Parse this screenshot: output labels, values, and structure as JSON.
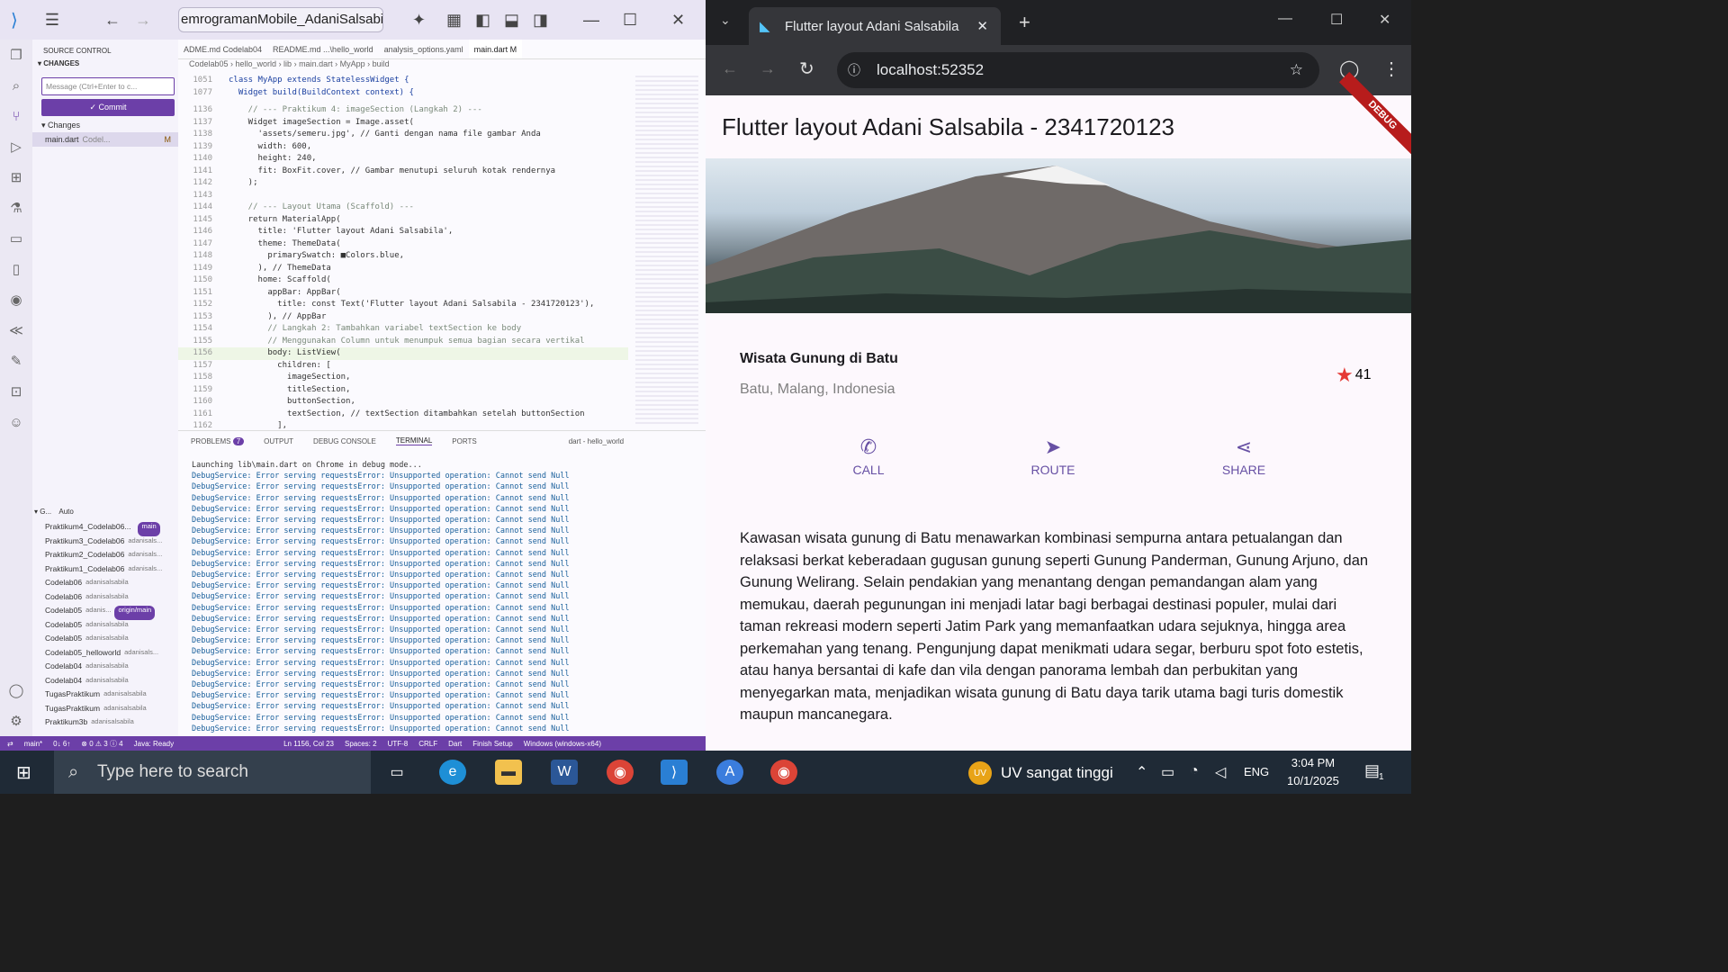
{
  "vscode": {
    "search_text": "emrogramanMobile_AdaniSalsabila",
    "sidebar": {
      "title": "SOURCE CONTROL",
      "changes_header": "CHANGES",
      "message_placeholder": "Message (Ctrl+Enter to c...",
      "commit_label": "✓ Commit",
      "changes_group": "Changes",
      "changed_file": "main.dart",
      "changed_file_path": "Codel...",
      "changed_file_status": "M",
      "graph_header": "G...",
      "graph_auto": "Auto",
      "commits": [
        {
          "msg": "Praktikum4_Codelab06...",
          "author": "",
          "badge": "main"
        },
        {
          "msg": "Praktikum3_Codelab06",
          "author": "adanisals..."
        },
        {
          "msg": "Praktikum2_Codelab06",
          "author": "adanisals..."
        },
        {
          "msg": "Praktikum1_Codelab06",
          "author": "adanisals..."
        },
        {
          "msg": "Codelab06",
          "author": "adanisalsabila"
        },
        {
          "msg": "Codelab06",
          "author": "adanisalsabila"
        },
        {
          "msg": "Codelab05",
          "author": "adanis...",
          "badge": "origin/main"
        },
        {
          "msg": "Codelab05",
          "author": "adanisalsabila"
        },
        {
          "msg": "Codelab05",
          "author": "adanisalsabila"
        },
        {
          "msg": "Codelab05_helloworld",
          "author": "adanisals..."
        },
        {
          "msg": "Codelab04",
          "author": "adanisalsabila"
        },
        {
          "msg": "Codelab04",
          "author": "adanisalsabila"
        },
        {
          "msg": "TugasPraktikum",
          "author": "adanisalsabila"
        },
        {
          "msg": "TugasPraktikum",
          "author": "adanisalsabila"
        },
        {
          "msg": "Praktikum3b",
          "author": "adanisalsabila"
        }
      ]
    },
    "tabs": [
      "ADME.md Codelab04",
      "README.md ...\\hello_world",
      "analysis_options.yaml",
      "main.dart M"
    ],
    "breadcrumb": "Codelab05 › hello_world › lib › main.dart › MyApp › build",
    "sticky": [
      {
        "n": "1051",
        "t": "class MyApp extends StatelessWidget {"
      },
      {
        "n": "1077",
        "t": "  Widget build(BuildContext context) {"
      }
    ],
    "code": [
      {
        "n": "1136",
        "t": "    // --- Praktikum 4: imageSection (Langkah 2) ---"
      },
      {
        "n": "1137",
        "t": "    Widget imageSection = Image.asset("
      },
      {
        "n": "1138",
        "t": "      'assets/semeru.jpg', // Ganti dengan nama file gambar Anda"
      },
      {
        "n": "1139",
        "t": "      width: 600,"
      },
      {
        "n": "1140",
        "t": "      height: 240,"
      },
      {
        "n": "1141",
        "t": "      fit: BoxFit.cover, // Gambar menutupi seluruh kotak rendernya"
      },
      {
        "n": "1142",
        "t": "    );"
      },
      {
        "n": "1143",
        "t": ""
      },
      {
        "n": "1144",
        "t": "    // --- Layout Utama (Scaffold) ---"
      },
      {
        "n": "1145",
        "t": "    return MaterialApp("
      },
      {
        "n": "1146",
        "t": "      title: 'Flutter layout Adani Salsabila',"
      },
      {
        "n": "1147",
        "t": "      theme: ThemeData("
      },
      {
        "n": "1148",
        "t": "        primarySwatch: ■Colors.blue,"
      },
      {
        "n": "1149",
        "t": "      ), // ThemeData"
      },
      {
        "n": "1150",
        "t": "      home: Scaffold("
      },
      {
        "n": "1151",
        "t": "        appBar: AppBar("
      },
      {
        "n": "1152",
        "t": "          title: const Text('Flutter layout Adani Salsabila - 2341720123'),"
      },
      {
        "n": "1153",
        "t": "        ), // AppBar"
      },
      {
        "n": "1154",
        "t": "        // Langkah 2: Tambahkan variabel textSection ke body"
      },
      {
        "n": "1155",
        "t": "        // Menggunakan Column untuk menumpuk semua bagian secara vertikal"
      },
      {
        "n": "1156",
        "t": "        body: ListView("
      },
      {
        "n": "1157",
        "t": "          children: ["
      },
      {
        "n": "1158",
        "t": "            imageSection,"
      },
      {
        "n": "1159",
        "t": "            titleSection,"
      },
      {
        "n": "1160",
        "t": "            buttonSection,"
      },
      {
        "n": "1161",
        "t": "            textSection, // textSection ditambahkan setelah buttonSection"
      },
      {
        "n": "1162",
        "t": "          ],"
      }
    ],
    "panel_tabs": [
      "PROBLEMS",
      "OUTPUT",
      "DEBUG CONSOLE",
      "TERMINAL",
      "PORTS"
    ],
    "problems_count": "7",
    "terminal_label": "dart - hello_world",
    "terminal_first": "Launching lib\\main.dart on Chrome in debug mode...",
    "terminal_line": "DebugService: Error serving requestsError: Unsupported operation: Cannot send Null",
    "terminal_repeat": 24,
    "status": [
      "main*",
      "0↓ 6↑",
      "⊗ 0 ⚠ 3 ⓘ 4",
      "Java: Ready",
      "Ln 1156, Col 23",
      "Spaces: 2",
      "UTF-8",
      "CRLF",
      "Dart",
      "Finish Setup",
      "Windows (windows-x64)"
    ]
  },
  "chrome": {
    "tab_title": "Flutter layout Adani Salsabila",
    "url": "localhost:52352",
    "debug_banner": "DEBUG",
    "app": {
      "appbar_title": "Flutter layout Adani Salsabila - 2341720123",
      "place_title": "Wisata Gunung di Batu",
      "place_location": "Batu, Malang, Indonesia",
      "star_count": "41",
      "buttons": [
        {
          "label": "CALL",
          "icon": "phone-icon"
        },
        {
          "label": "ROUTE",
          "icon": "near-me-icon"
        },
        {
          "label": "SHARE",
          "icon": "share-icon"
        }
      ],
      "description": "Kawasan wisata gunung di Batu menawarkan kombinasi sempurna antara petualangan dan relaksasi berkat keberadaan gugusan gunung seperti Gunung Panderman, Gunung Arjuno, dan Gunung Welirang. Selain pendakian yang menantang dengan pemandangan alam yang memukau, daerah pegunungan ini menjadi latar bagi berbagai destinasi populer, mulai dari taman rekreasi modern seperti Jatim Park yang memanfaatkan udara sejuknya, hingga area perkemahan yang tenang. Pengunjung dapat menikmati udara segar, berburu spot foto estetis, atau hanya bersantai di kafe dan vila dengan panorama lembah dan perbukitan yang menyegarkan mata, menjadikan wisata gunung di Batu daya tarik utama bagi turis domestik maupun mancanegara."
    },
    "colors": {
      "accent": "#6750a4",
      "star": "#e53935"
    }
  },
  "taskbar": {
    "search_placeholder": "Type here to search",
    "weather": "UV sangat tinggi",
    "weather_badge": "UV",
    "lang": "ENG",
    "time": "3:04 PM",
    "date": "10/1/2025",
    "notif_count": "1"
  }
}
